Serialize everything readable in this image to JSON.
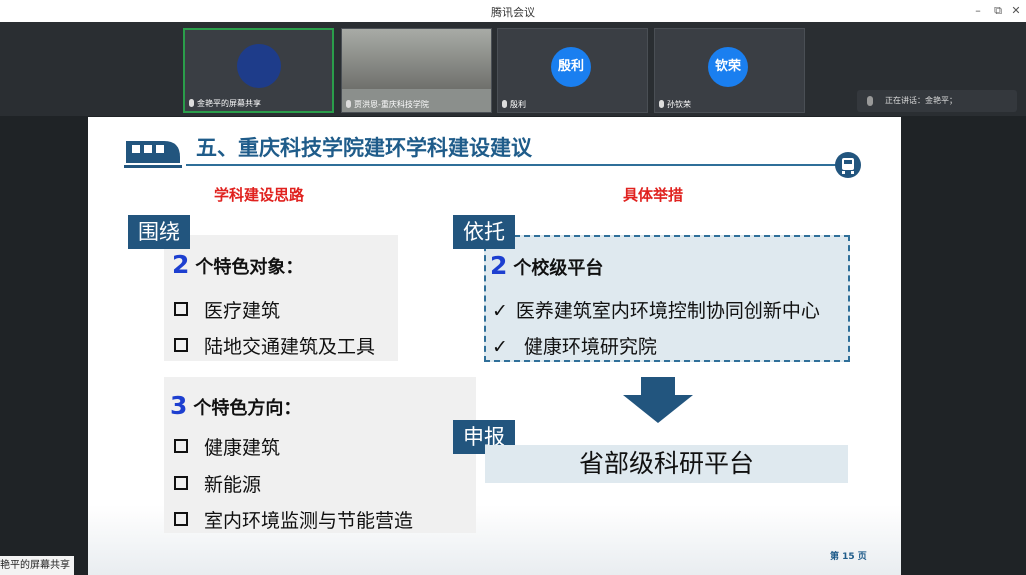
{
  "window": {
    "title": "腾讯会议",
    "minimize_glyph": "–",
    "maximize_glyph": "⧉",
    "close_glyph": "✕"
  },
  "participants": [
    {
      "name": "金艳平的屏幕共享",
      "avatar_text": ""
    },
    {
      "name": "贾洪恩-重庆科技学院",
      "avatar_text": ""
    },
    {
      "name": "殷利",
      "avatar_text": "殷利"
    },
    {
      "name": "孙钦荣",
      "avatar_text": "钦荣"
    }
  ],
  "speaking": "正在讲话：金艳平；",
  "slide": {
    "title": "五、重庆科技学院建环学科建设建议",
    "left_subtitle": "学科建设思路",
    "right_subtitle": "具体举措",
    "tag_surround": "围绕",
    "tag_rely": "依托",
    "tag_apply": "申报",
    "group1": {
      "num": "2",
      "label": "个特色对象：",
      "items": [
        "医疗建筑",
        "陆地交通建筑及工具"
      ]
    },
    "group2": {
      "num": "3",
      "label": "个特色方向：",
      "items": [
        "健康建筑",
        "新能源",
        "室内环境监测与节能营造"
      ]
    },
    "platform": {
      "num": "2",
      "label": "个校级平台",
      "items": [
        "医养建筑室内环境控制协同创新中心",
        "健康环境研究院"
      ]
    },
    "target": "省部级科研平台",
    "page": "第 15 页"
  },
  "share_label": "艳平的屏幕共享",
  "colors": {
    "accent": "#22557e",
    "red": "#e0221f",
    "blue_num": "#1d3fd0",
    "avatar": "#1a7ff0"
  },
  "icons": [
    "train-icon",
    "train-badge-icon",
    "down-arrow-icon",
    "mic-icon",
    "check-icon",
    "square-icon"
  ]
}
